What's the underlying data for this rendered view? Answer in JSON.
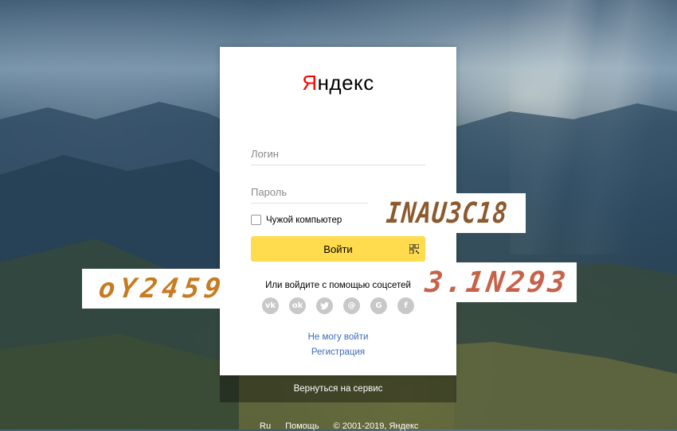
{
  "brand": {
    "logo_first": "Я",
    "logo_rest": "ндекс"
  },
  "form": {
    "login_placeholder": "Логин",
    "password_placeholder": "Пароль",
    "foreign_computer_label": "Чужой компьютер",
    "submit_label": "Войти",
    "qr_icon": "qr-code-icon"
  },
  "social": {
    "title": "Или войдите с помощью соцсетей",
    "providers": [
      {
        "name": "vk",
        "glyph": "vk"
      },
      {
        "name": "odnoklassniki",
        "glyph": "ok"
      },
      {
        "name": "twitter",
        "glyph": "tw"
      },
      {
        "name": "mail",
        "glyph": "@"
      },
      {
        "name": "google",
        "glyph": "G"
      },
      {
        "name": "facebook",
        "glyph": "f"
      }
    ]
  },
  "links": {
    "cant_login": "Не могу войти",
    "register": "Регистрация",
    "back_to_service": "Вернуться на сервис"
  },
  "footer": {
    "lang": "Ru",
    "help": "Помощь",
    "copyright": "© 2001-2019, Яндекс"
  },
  "captchas": [
    {
      "text": "INAU3C18"
    },
    {
      "text": "oY2459"
    },
    {
      "text": "3.1N293"
    }
  ],
  "colors": {
    "accent_yellow": "#ffdb4d",
    "logo_red": "#ff0000",
    "link_blue": "#3c6bb8"
  }
}
